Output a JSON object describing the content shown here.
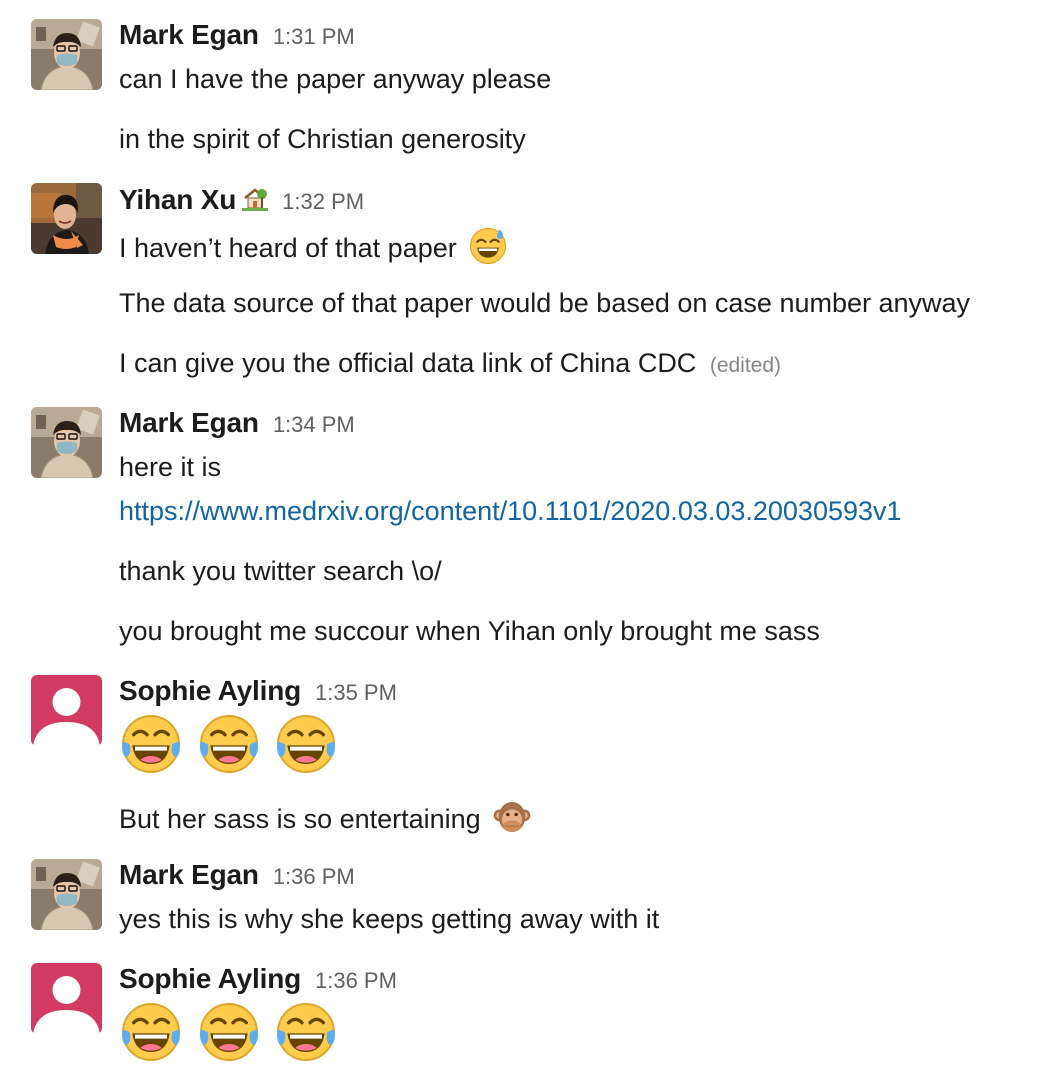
{
  "messages": [
    {
      "author": "Mark Egan",
      "time": "1:31 PM",
      "lines": [
        "can I have the paper anyway please",
        "in the spirit of Christian generosity"
      ]
    },
    {
      "author": "Yihan Xu",
      "status_icon": "house-with-garden-icon",
      "time": "1:32 PM",
      "lines": [
        "I haven’t heard of that paper",
        "The data source of that paper would be based on case number anyway",
        "I can give you the official data link of China CDC"
      ],
      "edited_label": "(edited)"
    },
    {
      "author": "Mark Egan",
      "time": "1:34 PM",
      "lines": [
        "here it is",
        "https://www.medrxiv.org/content/10.1101/2020.03.03.20030593v1",
        "thank you twitter search \\o/",
        "you brought me succour when Yihan only brought me sass"
      ]
    },
    {
      "author": "Sophie Ayling",
      "time": "1:35 PM",
      "lines": [
        "",
        "But her sass is so entertaining"
      ]
    },
    {
      "author": "Mark Egan",
      "time": "1:36 PM",
      "lines": [
        "yes this is why she keeps getting away with it"
      ]
    },
    {
      "author": "Sophie Ayling",
      "time": "1:36 PM",
      "lines": [
        ""
      ]
    }
  ],
  "colors": {
    "link": "#1264a3",
    "default_avatar_bg": "#d13b62",
    "timestamp": "#616061"
  }
}
